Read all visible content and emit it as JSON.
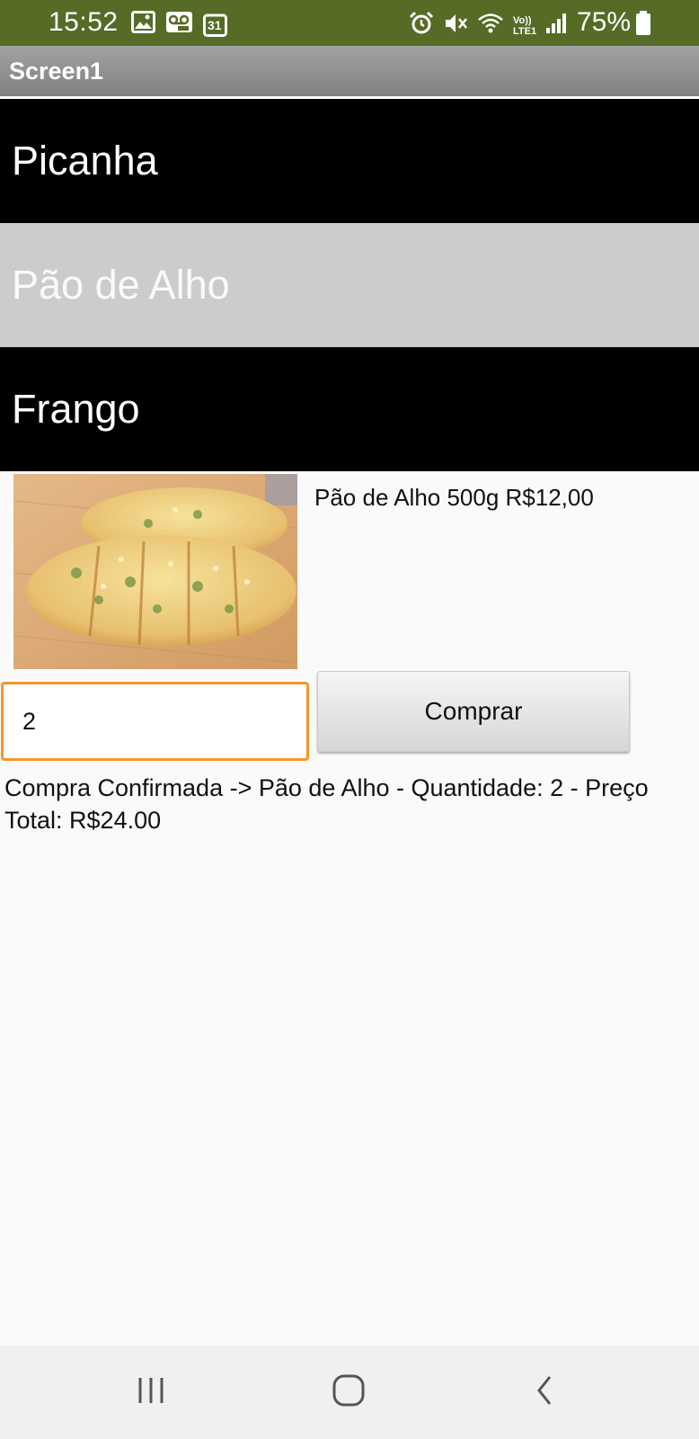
{
  "status_bar": {
    "time": "15:52",
    "battery": "75%",
    "left_icons": [
      "image-icon",
      "voicemail-icon",
      "calendar-icon"
    ],
    "calendar_day": "31",
    "right_icons": [
      "alarm-icon",
      "mute-icon",
      "wifi-icon",
      "volte-icon",
      "signal-icon",
      "battery-icon"
    ],
    "volte_top": "Vo))",
    "volte_bottom": "LTE1",
    "color": "#566b26"
  },
  "app": {
    "title": "Screen1"
  },
  "menu": {
    "items": [
      {
        "label": "Picanha"
      },
      {
        "label": "Pão de Alho"
      },
      {
        "label": "Frango"
      }
    ],
    "selected_index": 1
  },
  "product": {
    "image": "garlic-bread-image",
    "description": "Pão de Alho 500g R$12,00"
  },
  "order": {
    "quantity_value": "2",
    "buy_label": "Comprar",
    "accent_color": "#f5962a"
  },
  "confirmation": {
    "text": "Compra Confirmada -> Pão de Alho - Quantidade: 2 - Preço Total: R$24.00"
  },
  "nav_bar": {
    "buttons": [
      "recents-icon",
      "home-icon",
      "back-icon"
    ]
  }
}
